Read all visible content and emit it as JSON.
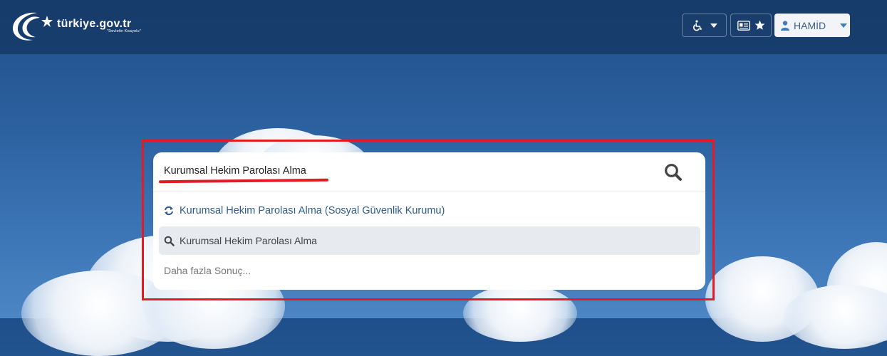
{
  "header": {
    "logo_text": "türkiye.gov.tr",
    "logo_tagline": "\"Devletin Kısayolu\"",
    "accessibility_icon": "wheelchair-icon",
    "id_card_icon": "id-card-icon",
    "favorites_icon": "star-icon",
    "user_icon": "user-icon",
    "user_name": "HAMİD"
  },
  "search": {
    "value": "Kurumsal Hekim Parolası Alma",
    "submit_icon": "search-icon"
  },
  "suggestions": [
    {
      "label": "Kurumsal Hekim Parolası Alma (Sosyal Güvenlik Kurumu)",
      "icon": "refresh-icon"
    },
    {
      "label": "Kurumsal Hekim Parolası Alma",
      "icon": "search-icon"
    }
  ],
  "more_results": "Daha fazla Sonuç...",
  "colors": {
    "highlight": "#e31b23",
    "link": "#2d5a8c",
    "header_bg": "#1f4a80"
  }
}
